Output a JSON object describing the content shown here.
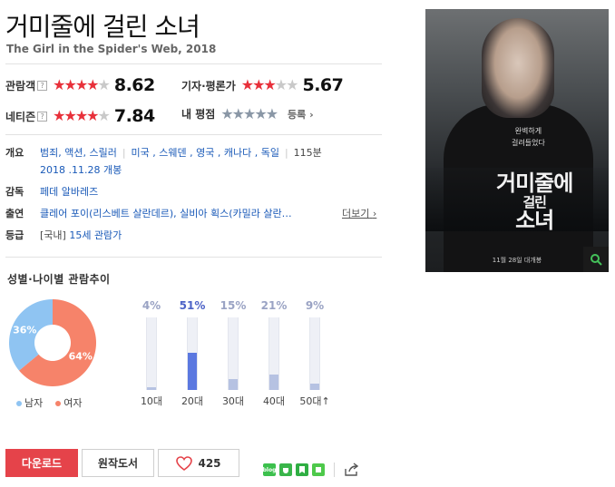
{
  "movie": {
    "title": "거미줄에 걸린 소녀",
    "subtitle": "The Girl in the Spider's Web, 2018"
  },
  "ratings": {
    "audience": {
      "label": "관람객",
      "help": "?",
      "stars": 4.3,
      "score": "8.62"
    },
    "critic": {
      "label": "기자·평론가",
      "stars": 2.8,
      "score": "5.67"
    },
    "netizen": {
      "label": "네티즌",
      "help": "?",
      "stars": 3.9,
      "score": "7.84"
    },
    "mine": {
      "label": "내 평점",
      "stars": 0,
      "register": "등록"
    }
  },
  "info": {
    "overview_label": "개요",
    "genres": "범죄, 액션, 스릴러",
    "countries": "미국 , 스웨덴 , 영국 , 캐나다 , 독일",
    "runtime": "115분",
    "release": "2018 .11.28 개봉",
    "director_label": "감독",
    "director": "페데 알바레즈",
    "cast_label": "출연",
    "cast": "클레어 포이(리스베트 살란데르), 실비아 획스(카밀라 살란…",
    "more": "더보기",
    "grade_label": "등급",
    "grade_prefix": "[국내]",
    "grade": "15세 관람가"
  },
  "poster": {
    "tagline_1": "완벽하게",
    "tagline_2": "걸려들었다",
    "title_1": "거미줄에",
    "title_2": "걸린",
    "title_3": "소녀",
    "footer": "11월 28일 대개봉"
  },
  "trend": {
    "title": "성별·나이별 관람추이",
    "gender": [
      {
        "name": "남자",
        "pct": 36,
        "label": "36%",
        "color": "#8fc4f2"
      },
      {
        "name": "여자",
        "pct": 64,
        "label": "64%",
        "color": "#f6836a"
      }
    ],
    "ages": [
      {
        "label": "10대",
        "pct": 4,
        "pct_label": "4%"
      },
      {
        "label": "20대",
        "pct": 51,
        "pct_label": "51%"
      },
      {
        "label": "30대",
        "pct": 15,
        "pct_label": "15%"
      },
      {
        "label": "40대",
        "pct": 21,
        "pct_label": "21%"
      },
      {
        "label": "50대↑",
        "pct": 9,
        "pct_label": "9%"
      }
    ]
  },
  "actions": {
    "download": "다운로드",
    "original": "원작도서",
    "likes": "425",
    "blog_icon_text": "blog"
  },
  "chart_data": [
    {
      "type": "pie",
      "title": "성별·나이별 관람추이",
      "categories": [
        "남자",
        "여자"
      ],
      "values": [
        36,
        64
      ]
    },
    {
      "type": "bar",
      "categories": [
        "10대",
        "20대",
        "30대",
        "40대",
        "50대↑"
      ],
      "values": [
        4,
        51,
        15,
        21,
        9
      ],
      "ylim": [
        0,
        100
      ]
    }
  ],
  "colors": {
    "accent_red": "#e5434a",
    "star_red": "#e8303a",
    "bar_max": "#5b78e0",
    "bar": "#b6c2e2",
    "male": "#8fc4f2",
    "female": "#f6836a"
  }
}
